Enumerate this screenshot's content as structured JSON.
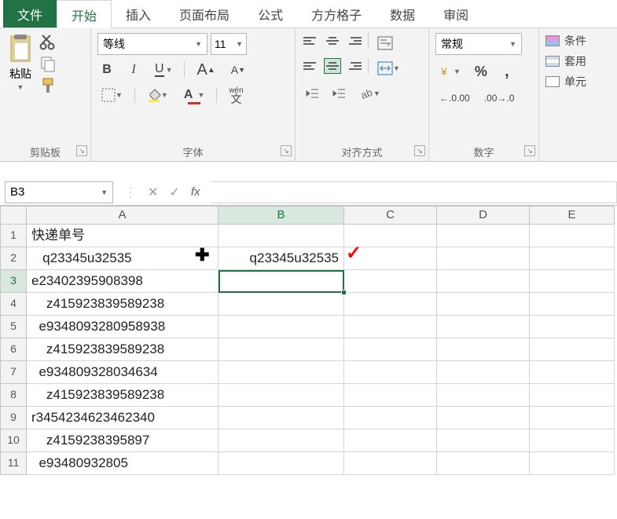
{
  "tabs": {
    "file": "文件",
    "home": "开始",
    "insert": "插入",
    "pagelayout": "页面布局",
    "formulas": "公式",
    "ffgz": "方方格子",
    "data": "数据",
    "review": "审阅"
  },
  "ribbon": {
    "clipboard": {
      "paste": "粘贴",
      "label": "剪贴板"
    },
    "font": {
      "name": "等线",
      "size": "11",
      "bold": "B",
      "italic": "I",
      "underline": "U",
      "grow": "A",
      "shrink": "A",
      "ruby": "wén",
      "ruby2": "文",
      "label": "字体"
    },
    "alignment": {
      "label": "对齐方式"
    },
    "number": {
      "format": "常规",
      "percent": "%",
      "comma": ",",
      "inc": ".0",
      "dec": ".00",
      "label": "数字"
    },
    "styles": {
      "cond": "条件",
      "table": "套用",
      "cell": "单元"
    }
  },
  "fbar": {
    "namebox": "B3",
    "fx": "fx"
  },
  "grid": {
    "cols": [
      "A",
      "B",
      "C",
      "D",
      "E"
    ],
    "rows": [
      {
        "n": "1",
        "A": "快递单号",
        "B": ""
      },
      {
        "n": "2",
        "A": "   q23345u32535",
        "B": "q23345u32535"
      },
      {
        "n": "3",
        "A": "e23402395908398",
        "B": ""
      },
      {
        "n": "4",
        "A": "    z415923839589238",
        "B": ""
      },
      {
        "n": "5",
        "A": "  e9348093280958938",
        "B": ""
      },
      {
        "n": "6",
        "A": "    z415923839589238",
        "B": ""
      },
      {
        "n": "7",
        "A": "  e934809328034634",
        "B": ""
      },
      {
        "n": "8",
        "A": "    z415923839589238",
        "B": ""
      },
      {
        "n": "9",
        "A": "r3454234623462340",
        "B": ""
      },
      {
        "n": "10",
        "A": "    z4159238395897",
        "B": ""
      },
      {
        "n": "11",
        "A": "  e93480932805",
        "B": ""
      }
    ],
    "selected": {
      "row": 3,
      "col": "B"
    }
  }
}
